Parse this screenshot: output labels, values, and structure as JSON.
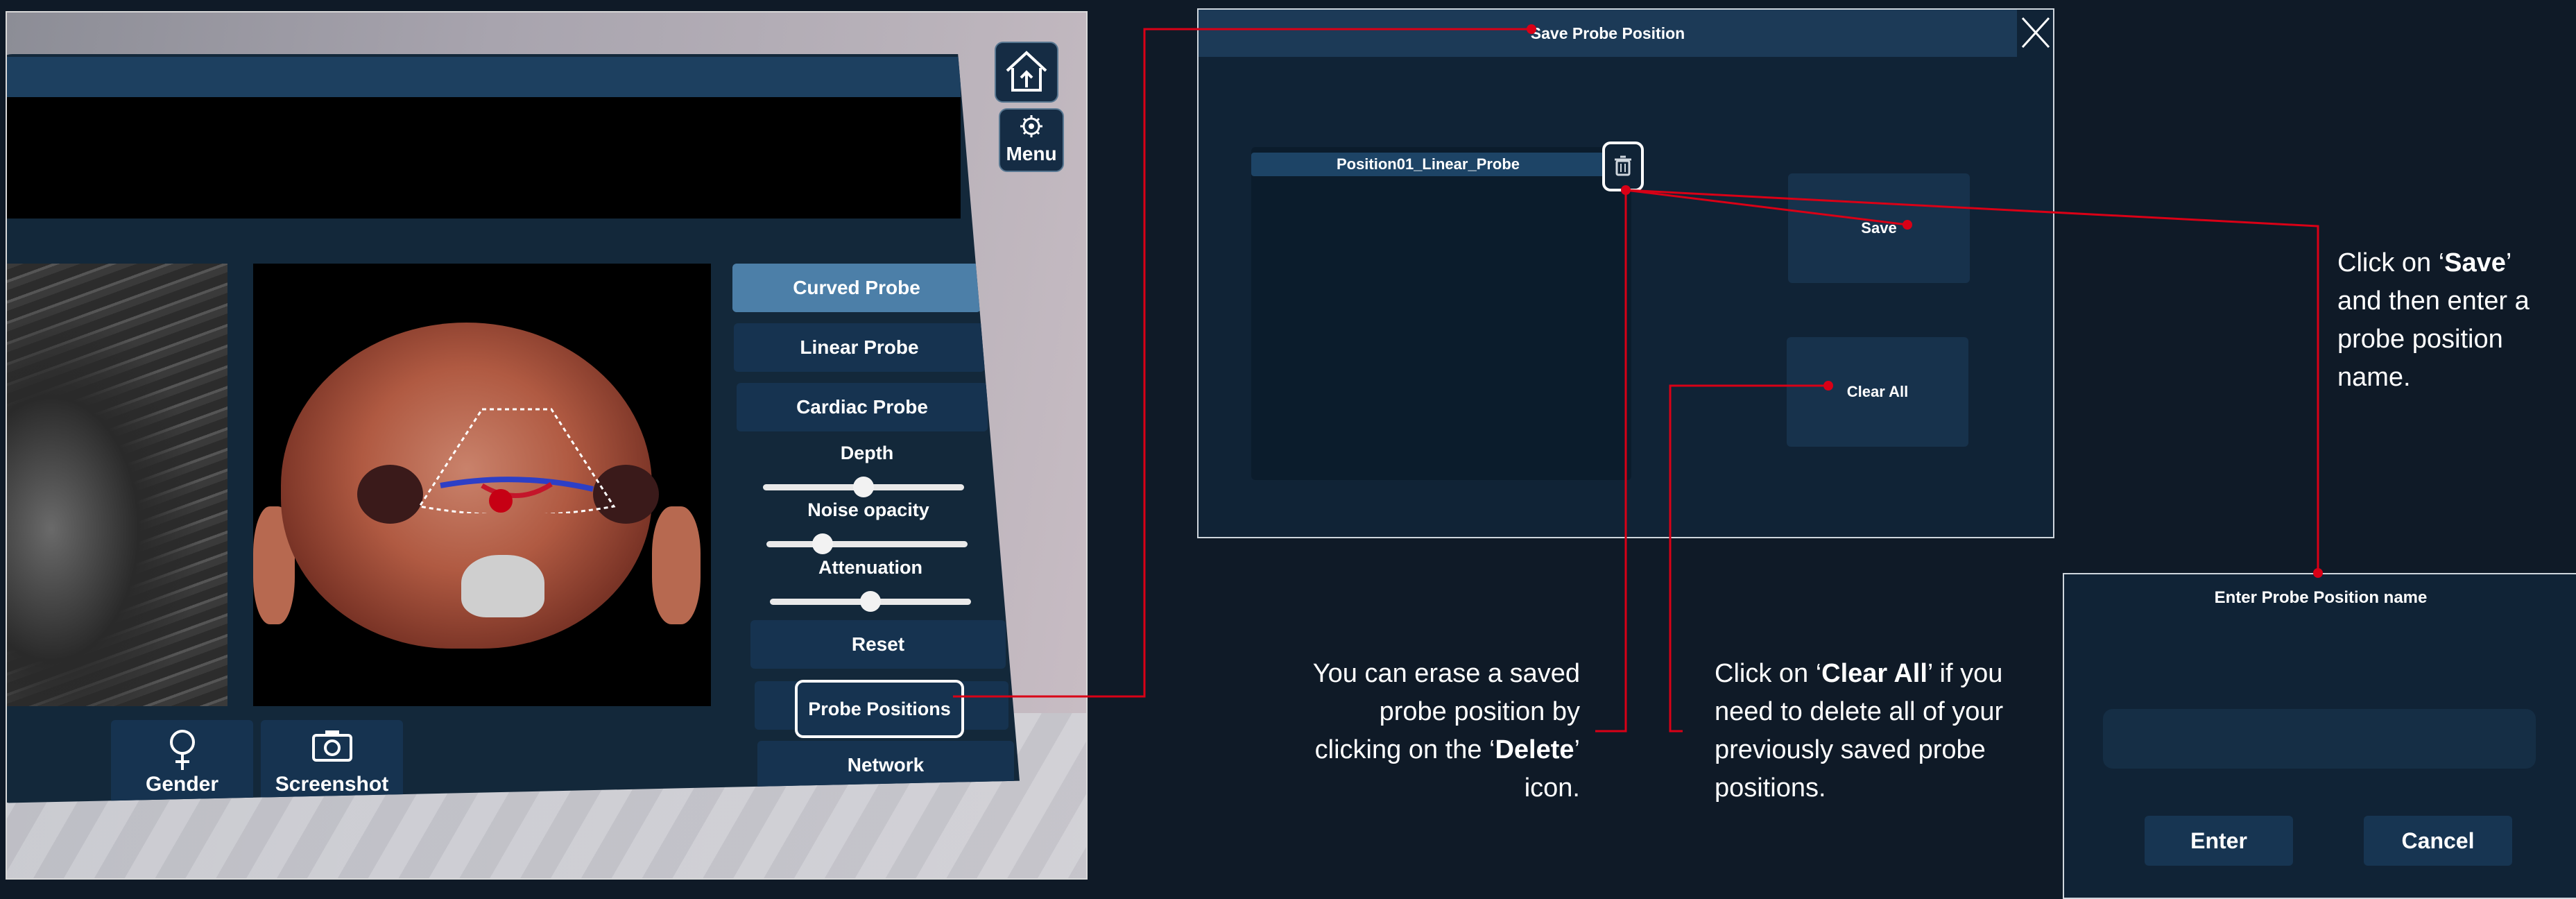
{
  "colors": {
    "background": "#0f1a27",
    "panel": "#13283a",
    "button": "#163350",
    "button_active": "#4c7fa8",
    "connector": "#d90016"
  },
  "vr_app": {
    "menu_label": "Menu",
    "probe_buttons": {
      "curved": "Curved Probe",
      "linear": "Linear Probe",
      "cardiac": "Cardiac Probe",
      "active": "curved"
    },
    "sliders": {
      "depth": {
        "label": "Depth",
        "value": 0.5
      },
      "noise_opacity": {
        "label": "Noise opacity",
        "value": 0.28
      },
      "attenuation": {
        "label": "Attenuation",
        "value": 0.5
      }
    },
    "reset_label": "Reset",
    "probe_positions_label": "Probe Positions",
    "network_label": "Network",
    "gender_label": "Gender",
    "screenshot_label": "Screenshot",
    "icons": {
      "home": "home-icon",
      "menu": "gear-icon",
      "gender": "female-icon",
      "screenshot": "camera-icon"
    }
  },
  "save_dialog": {
    "title": "Save Probe Position",
    "saved_positions": [
      "Position01_Linear_Probe"
    ],
    "save_label": "Save",
    "clear_all_label": "Clear All",
    "icons": {
      "close": "close-icon",
      "delete": "trash-icon"
    }
  },
  "name_dialog": {
    "title": "Enter Probe Position name",
    "input_value": "",
    "enter_label": "Enter",
    "cancel_label": "Cancel"
  },
  "annotations": {
    "save_note": {
      "prefix": "Click on ‘",
      "bold": "Save",
      "suffix": "’ and then enter a probe position name."
    },
    "delete_note": {
      "prefix": "You can erase a saved probe position by clicking on the ‘",
      "bold": "Delete",
      "suffix": "’ icon."
    },
    "clear_note": {
      "prefix": "Click on ‘",
      "bold": "Clear All",
      "suffix": "’ if you need to delete all of your previously saved probe positions."
    }
  }
}
